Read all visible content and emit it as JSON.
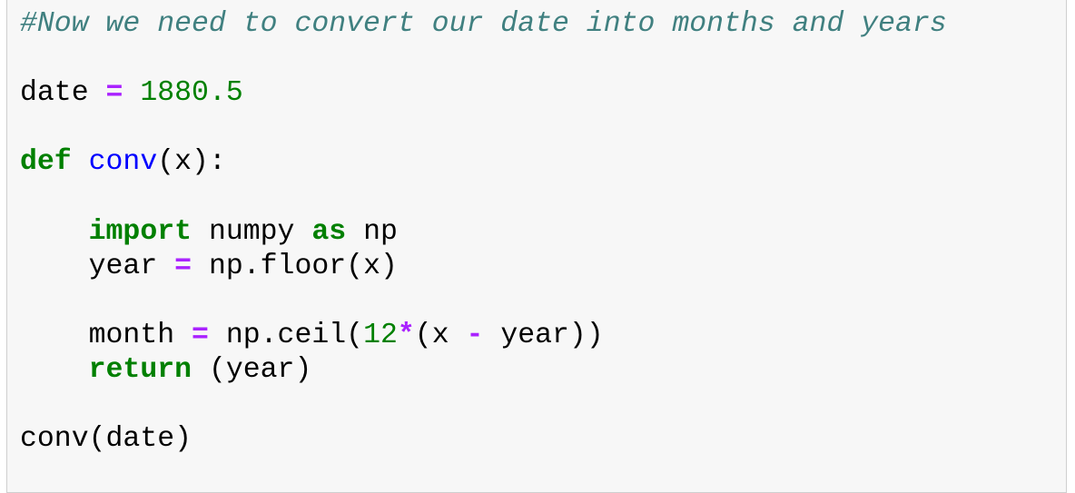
{
  "cell": {
    "lines": [
      [
        [
          "comment",
          "#Now we need to convert our date into months and years"
        ]
      ],
      [],
      [
        [
          "txt",
          "date "
        ],
        [
          "op",
          "="
        ],
        [
          "txt",
          " "
        ],
        [
          "num",
          "1880.5"
        ]
      ],
      [],
      [
        [
          "kw",
          "def"
        ],
        [
          "txt",
          " "
        ],
        [
          "fn",
          "conv"
        ],
        [
          "txt",
          "(x):"
        ]
      ],
      [],
      [
        [
          "txt",
          "    "
        ],
        [
          "kw",
          "import"
        ],
        [
          "txt",
          " numpy "
        ],
        [
          "kw",
          "as"
        ],
        [
          "txt",
          " np"
        ]
      ],
      [
        [
          "txt",
          "    year "
        ],
        [
          "op",
          "="
        ],
        [
          "txt",
          " np.floor(x)"
        ]
      ],
      [],
      [
        [
          "txt",
          "    month "
        ],
        [
          "op",
          "="
        ],
        [
          "txt",
          " np.ceil("
        ],
        [
          "num",
          "12"
        ],
        [
          "op",
          "*"
        ],
        [
          "txt",
          "(x "
        ],
        [
          "op",
          "-"
        ],
        [
          "txt",
          " year))"
        ]
      ],
      [
        [
          "txt",
          "    "
        ],
        [
          "kw",
          "return"
        ],
        [
          "txt",
          " (year)"
        ]
      ],
      [],
      [
        [
          "txt",
          "conv(date)"
        ]
      ]
    ]
  }
}
